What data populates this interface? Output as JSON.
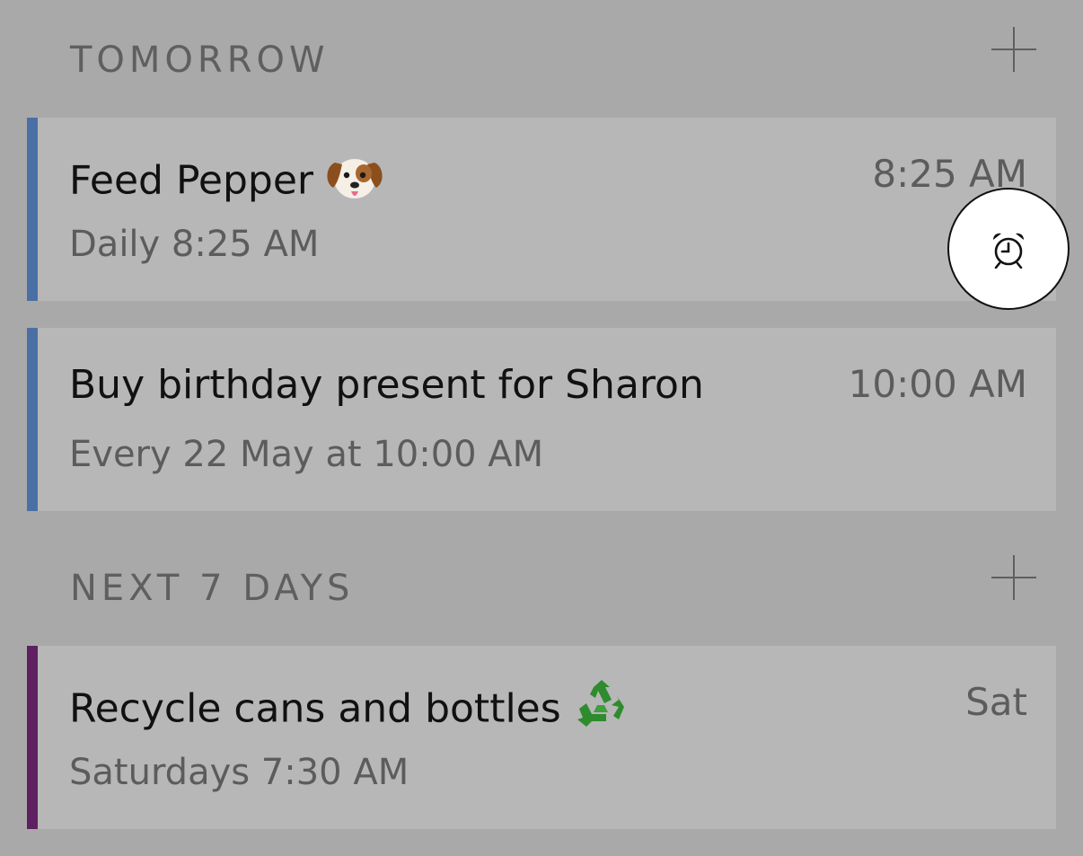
{
  "sections": [
    {
      "title": "TOMORROW",
      "reminders": [
        {
          "title": "Feed Pepper",
          "emoji": "dog-face-icon",
          "schedule": "Daily 8:25 AM",
          "time": "8:25 AM",
          "accent_color": "#4a6fa5"
        },
        {
          "title": "Buy birthday present for Sharon",
          "schedule": "Every 22 May at 10:00 AM",
          "time": "10:00 AM",
          "accent_color": "#4a6fa5"
        }
      ]
    },
    {
      "title": "NEXT 7 DAYS",
      "reminders": [
        {
          "title": "Recycle cans and bottles",
          "emoji": "recycle-icon",
          "schedule": "Saturdays 7:30 AM",
          "time": "Sat",
          "accent_color": "#5e2060"
        }
      ]
    }
  ],
  "floating_action": {
    "icon": "alarm-clock-icon"
  }
}
